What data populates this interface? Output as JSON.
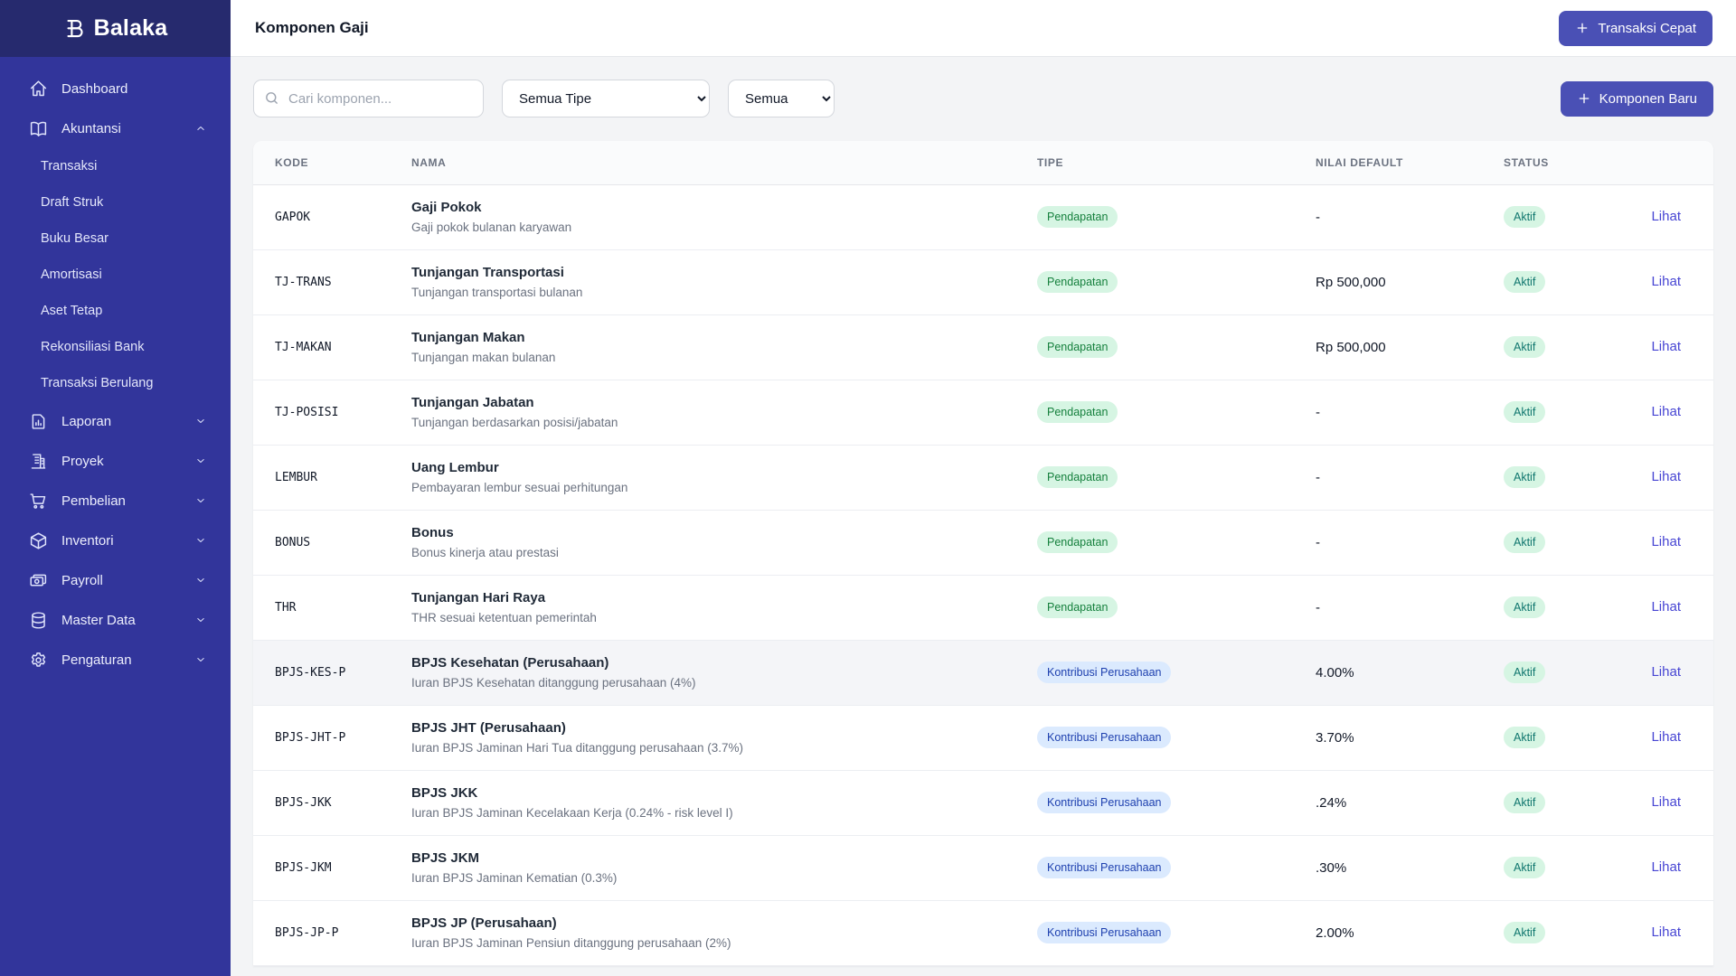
{
  "app": {
    "name": "Balaka"
  },
  "sidebar": {
    "items": [
      {
        "label": "Dashboard",
        "icon": "home-icon"
      },
      {
        "label": "Akuntansi",
        "icon": "book-icon",
        "expanded": true,
        "children": [
          "Transaksi",
          "Draft Struk",
          "Buku Besar",
          "Amortisasi",
          "Aset Tetap",
          "Rekonsiliasi Bank",
          "Transaksi Berulang"
        ]
      },
      {
        "label": "Laporan",
        "icon": "report-icon",
        "expanded": false
      },
      {
        "label": "Proyek",
        "icon": "building-icon",
        "expanded": false
      },
      {
        "label": "Pembelian",
        "icon": "cart-icon",
        "expanded": false
      },
      {
        "label": "Inventori",
        "icon": "cube-icon",
        "expanded": false
      },
      {
        "label": "Payroll",
        "icon": "banknotes-icon",
        "expanded": false
      },
      {
        "label": "Master Data",
        "icon": "database-icon",
        "expanded": false
      },
      {
        "label": "Pengaturan",
        "icon": "gear-icon",
        "expanded": false
      }
    ]
  },
  "header": {
    "title": "Komponen Gaji",
    "quick_action_label": "Transaksi Cepat"
  },
  "filters": {
    "search_placeholder": "Cari komponen...",
    "type_filter_value": "Semua Tipe",
    "status_filter_value": "Semua",
    "new_button_label": "Komponen Baru"
  },
  "table": {
    "columns": [
      "KODE",
      "NAMA",
      "TIPE",
      "NILAI DEFAULT",
      "STATUS"
    ],
    "action_label": "Lihat",
    "rows": [
      {
        "kode": "GAPOK",
        "nama": "Gaji Pokok",
        "desc": "Gaji pokok bulanan karyawan",
        "tipe": "Pendapatan",
        "tipe_kind": "income",
        "nilai": "-",
        "status": "Aktif",
        "highlight": false
      },
      {
        "kode": "TJ-TRANS",
        "nama": "Tunjangan Transportasi",
        "desc": "Tunjangan transportasi bulanan",
        "tipe": "Pendapatan",
        "tipe_kind": "income",
        "nilai": "Rp 500,000",
        "status": "Aktif",
        "highlight": false
      },
      {
        "kode": "TJ-MAKAN",
        "nama": "Tunjangan Makan",
        "desc": "Tunjangan makan bulanan",
        "tipe": "Pendapatan",
        "tipe_kind": "income",
        "nilai": "Rp 500,000",
        "status": "Aktif",
        "highlight": false
      },
      {
        "kode": "TJ-POSISI",
        "nama": "Tunjangan Jabatan",
        "desc": "Tunjangan berdasarkan posisi/jabatan",
        "tipe": "Pendapatan",
        "tipe_kind": "income",
        "nilai": "-",
        "status": "Aktif",
        "highlight": false
      },
      {
        "kode": "LEMBUR",
        "nama": "Uang Lembur",
        "desc": "Pembayaran lembur sesuai perhitungan",
        "tipe": "Pendapatan",
        "tipe_kind": "income",
        "nilai": "-",
        "status": "Aktif",
        "highlight": false
      },
      {
        "kode": "BONUS",
        "nama": "Bonus",
        "desc": "Bonus kinerja atau prestasi",
        "tipe": "Pendapatan",
        "tipe_kind": "income",
        "nilai": "-",
        "status": "Aktif",
        "highlight": false
      },
      {
        "kode": "THR",
        "nama": "Tunjangan Hari Raya",
        "desc": "THR sesuai ketentuan pemerintah",
        "tipe": "Pendapatan",
        "tipe_kind": "income",
        "nilai": "-",
        "status": "Aktif",
        "highlight": false
      },
      {
        "kode": "BPJS-KES-P",
        "nama": "BPJS Kesehatan (Perusahaan)",
        "desc": "Iuran BPJS Kesehatan ditanggung perusahaan (4%)",
        "tipe": "Kontribusi Perusahaan",
        "tipe_kind": "company",
        "nilai": "4.00%",
        "status": "Aktif",
        "highlight": true
      },
      {
        "kode": "BPJS-JHT-P",
        "nama": "BPJS JHT (Perusahaan)",
        "desc": "Iuran BPJS Jaminan Hari Tua ditanggung perusahaan (3.7%)",
        "tipe": "Kontribusi Perusahaan",
        "tipe_kind": "company",
        "nilai": "3.70%",
        "status": "Aktif",
        "highlight": false
      },
      {
        "kode": "BPJS-JKK",
        "nama": "BPJS JKK",
        "desc": "Iuran BPJS Jaminan Kecelakaan Kerja (0.24% - risk level I)",
        "tipe": "Kontribusi Perusahaan",
        "tipe_kind": "company",
        "nilai": ".24%",
        "status": "Aktif",
        "highlight": false
      },
      {
        "kode": "BPJS-JKM",
        "nama": "BPJS JKM",
        "desc": "Iuran BPJS Jaminan Kematian (0.3%)",
        "tipe": "Kontribusi Perusahaan",
        "tipe_kind": "company",
        "nilai": ".30%",
        "status": "Aktif",
        "highlight": false
      },
      {
        "kode": "BPJS-JP-P",
        "nama": "BPJS JP (Perusahaan)",
        "desc": "Iuran BPJS Jaminan Pensiun ditanggung perusahaan (2%)",
        "tipe": "Kontribusi Perusahaan",
        "tipe_kind": "company",
        "nilai": "2.00%",
        "status": "Aktif",
        "highlight": false
      }
    ]
  },
  "colors": {
    "sidebar": "#32359b",
    "sidebar_top": "#262a6e",
    "primary_button": "#4a50b5",
    "link": "#4745d3",
    "badge_income_bg": "#d6f5e3",
    "badge_income_text": "#15803d",
    "badge_company_bg": "#dbeafe",
    "badge_company_text": "#1e40af",
    "badge_status_bg": "#d6f5e3",
    "badge_status_text": "#0f766e"
  }
}
